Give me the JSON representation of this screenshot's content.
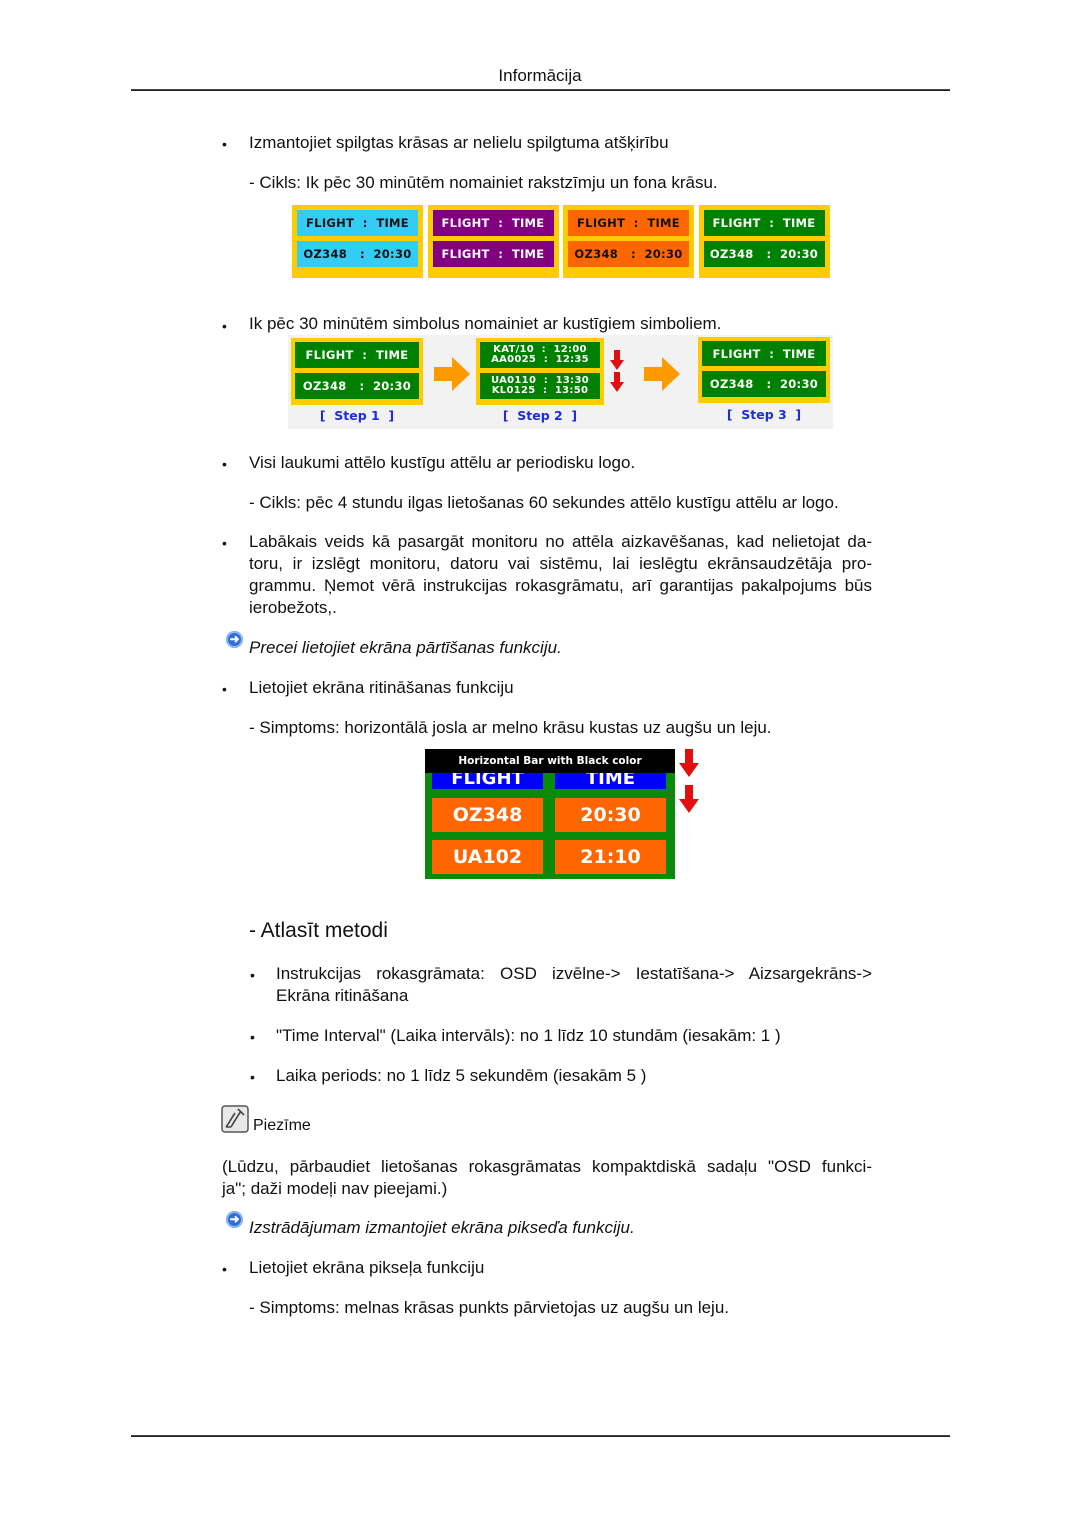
{
  "header": {
    "title": "Informācija"
  },
  "section1": {
    "bullet": "Izmantojiet spilgtas krāsas ar nelielu spilgtuma atšķirību",
    "sub": "- Cikls: Ik pēc 30 minūtēm nomainiet rakstzīmju un fona krāsu.",
    "boards": [
      {
        "bg": "#ffcc00",
        "cell": "#33ccf5",
        "fg": "#111111",
        "row1": "FLIGHT  :  TIME",
        "row2": "OZ348   :  20:30"
      },
      {
        "bg": "#ffcc00",
        "cell": "#800080",
        "fg": "#ffffff",
        "row1": "FLIGHT  :  TIME",
        "row2": "FLIGHT  :  TIME"
      },
      {
        "bg": "#ffcc00",
        "cell": "#ff6600",
        "fg": "#111111",
        "row1": "FLIGHT  :  TIME",
        "row2": "OZ348   :  20:30"
      },
      {
        "bg": "#ffcc00",
        "cell": "#008000",
        "fg": "#ffffff",
        "row1": "FLIGHT  :  TIME",
        "row2": "OZ348   :  20:30"
      }
    ]
  },
  "section2": {
    "bullet": "Ik pēc 30 minūtēm simbolus nomainiet ar kustīgiem simboliem.",
    "steps": [
      {
        "label": "[  Step 1  ]",
        "row1": "FLIGHT  :  TIME",
        "row2": "OZ348   :  20:30"
      },
      {
        "label": "[  Step 2  ]",
        "row1a": "KAT/10  :  12:00",
        "row1b": "AA0025  :  12:35",
        "row2a": "UA0110  :  13:30",
        "row2b": "KL0125  :  13:50"
      },
      {
        "label": "[  Step 3  ]",
        "row1": "FLIGHT  :  TIME",
        "row2": "OZ348   :  20:30"
      }
    ]
  },
  "section3": {
    "bullet": "Visi laukumi attēlo kustīgu attēlu ar periodisku logo.",
    "sub": "- Cikls: pēc 4 stundu ilgas lietošanas 60 sekundes attēlo kustīgu attēlu ar logo."
  },
  "section4": {
    "bullet": "Labākais veids kā pasargāt monitoru no attēla aizkavēšanas, kad nelietojat da-toru, ir izslēgt monitoru, datoru vai sistēmu, lai ieslēgtu ekrānsaudzētāja pro-grammu. Ņemot vērā instrukcijas rokasgrāmatu, arī garantijas pakalpojums būs ierobežots,.",
    "lines": [
      "Labākais veids kā pasargāt monitoru no attēla aizkavēšanas, kad nelietojat da-",
      "toru, ir izslēgt monitoru, datoru vai sistēmu, lai ieslēgtu ekrānsaudzētāja pro-",
      "grammu. Ņemot vērā instrukcijas rokasgrāmatu, arī garantijas pakalpojums būs",
      "ierobežots,."
    ]
  },
  "tip1": {
    "text": "Precei lietojiet ekrāna pārtīšanas funkciju."
  },
  "section5": {
    "bullet": "Lietojiet ekrāna ritināšanas funkciju",
    "sub": "- Simptoms: horizontālā josla ar melno krāsu kustas uz augšu un leju.",
    "scroll_image": {
      "bar_label": "Horizontal Bar with Black color",
      "header_left": "FLIGHT",
      "header_right": "TIME",
      "rows": [
        {
          "left": "OZ348",
          "right": "20:30"
        },
        {
          "left": "UA102",
          "right": "21:10"
        }
      ]
    }
  },
  "method": {
    "heading": "- Atlasīt metodi",
    "items": [
      {
        "lines": [
          "Instrukcijas rokasgrāmata: OSD izvēlne-> Iestatīšana-> Aizsargekrāns->",
          "Ekrāna ritināšana"
        ]
      },
      {
        "lines": [
          "\"Time Interval\" (Laika intervāls): no 1 līdz 10 stundām (iesakām: 1 )"
        ]
      },
      {
        "lines": [
          "Laika periods: no 1 līdz 5 sekundēm (iesakām 5 )"
        ]
      }
    ]
  },
  "note": {
    "label": "Piezīme",
    "lines": [
      "(Lūdzu, pārbaudiet lietošanas rokasgrāmatas kompaktdiskā sadaļu \"OSD funkci-",
      "ja\"; daži modeļi nav pieejami.)"
    ]
  },
  "tip2": {
    "text": "Izstrādājumam izmantojiet ekrāna pikseďa funkciju."
  },
  "section6": {
    "bullet": "Lietojiet ekrāna pikseļa funkciju",
    "sub": "- Simptoms: melnas krāsas punkts pārvietojas uz augšu un leju."
  },
  "colors": {
    "tip_icon": "#2f6fd6",
    "step_label": "#1d2ed6",
    "board_frame": "#ffcc00",
    "arrow_orange": "#ff9900",
    "arrow_red": "#e01010"
  }
}
